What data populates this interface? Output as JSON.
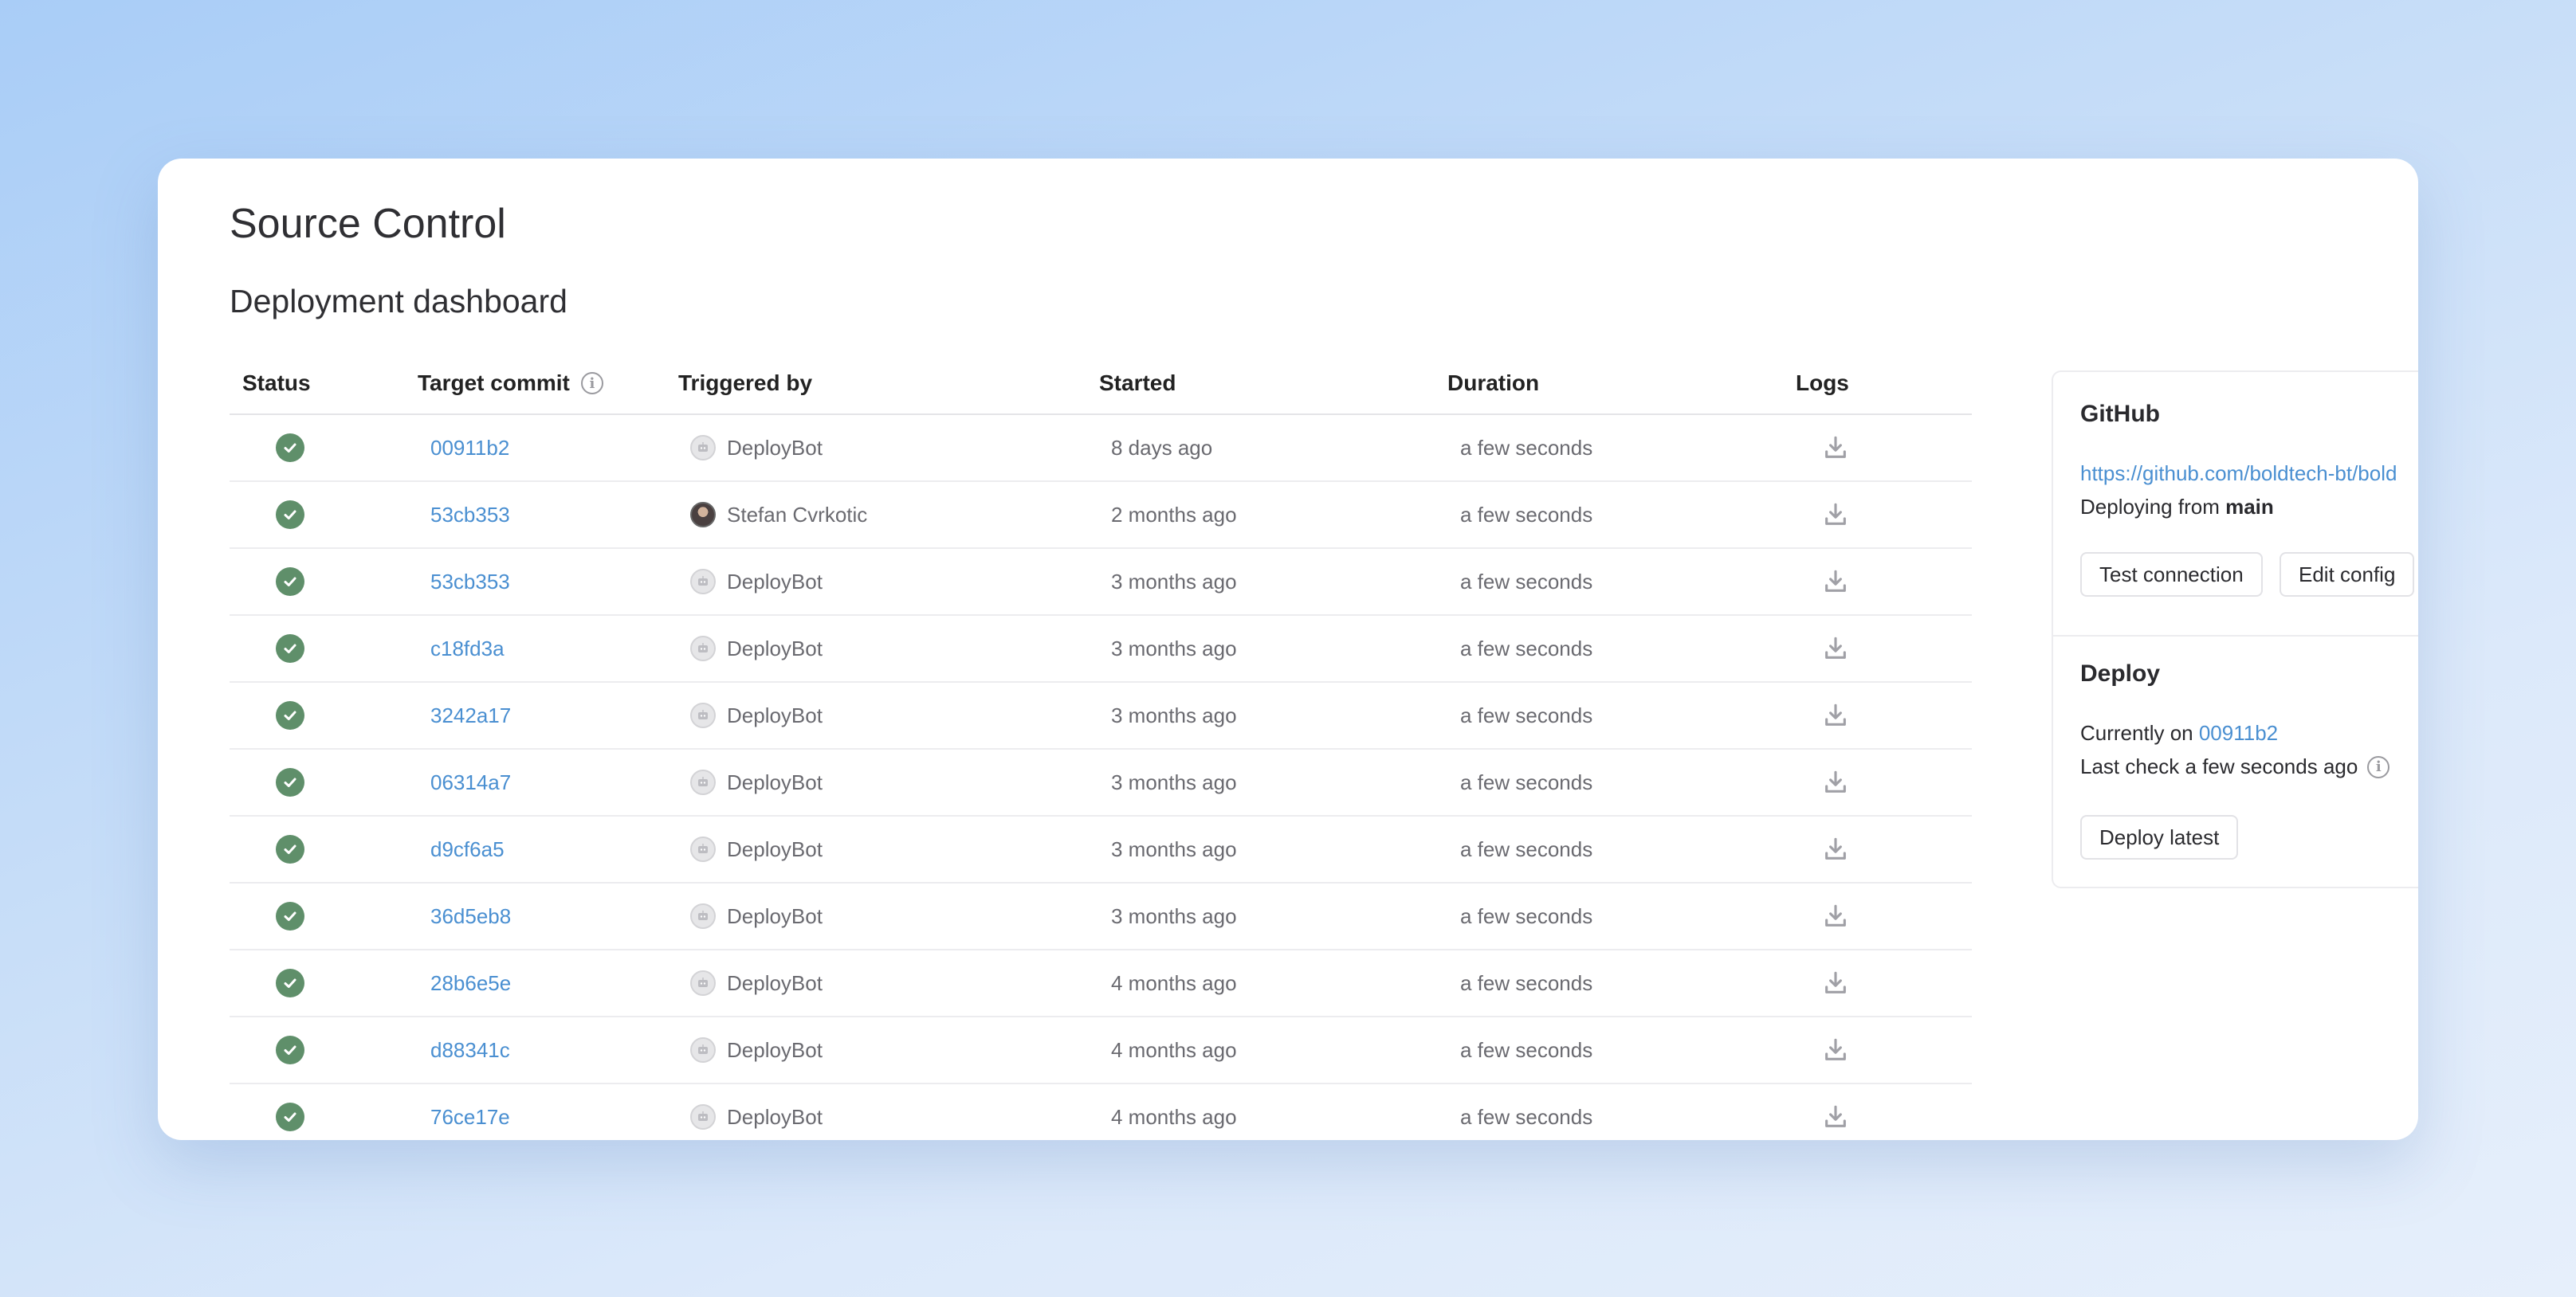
{
  "app_title": "Source Control",
  "section_title": "Deployment dashboard",
  "columns": {
    "status": "Status",
    "target_commit": "Target commit",
    "triggered_by": "Triggered by",
    "started": "Started",
    "duration": "Duration",
    "logs": "Logs"
  },
  "rows": [
    {
      "commit": "00911b2",
      "user": "DeployBot",
      "avatar": "bot",
      "started": "8 days ago",
      "duration": "a few seconds"
    },
    {
      "commit": "53cb353",
      "user": "Stefan Cvrkotic",
      "avatar": "person",
      "started": "2 months ago",
      "duration": "a few seconds"
    },
    {
      "commit": "53cb353",
      "user": "DeployBot",
      "avatar": "bot",
      "started": "3 months ago",
      "duration": "a few seconds"
    },
    {
      "commit": "c18fd3a",
      "user": "DeployBot",
      "avatar": "bot",
      "started": "3 months ago",
      "duration": "a few seconds"
    },
    {
      "commit": "3242a17",
      "user": "DeployBot",
      "avatar": "bot",
      "started": "3 months ago",
      "duration": "a few seconds"
    },
    {
      "commit": "06314a7",
      "user": "DeployBot",
      "avatar": "bot",
      "started": "3 months ago",
      "duration": "a few seconds"
    },
    {
      "commit": "d9cf6a5",
      "user": "DeployBot",
      "avatar": "bot",
      "started": "3 months ago",
      "duration": "a few seconds"
    },
    {
      "commit": "36d5eb8",
      "user": "DeployBot",
      "avatar": "bot",
      "started": "3 months ago",
      "duration": "a few seconds"
    },
    {
      "commit": "28b6e5e",
      "user": "DeployBot",
      "avatar": "bot",
      "started": "4 months ago",
      "duration": "a few seconds"
    },
    {
      "commit": "d88341c",
      "user": "DeployBot",
      "avatar": "bot",
      "started": "4 months ago",
      "duration": "a few seconds"
    },
    {
      "commit": "76ce17e",
      "user": "DeployBot",
      "avatar": "bot",
      "started": "4 months ago",
      "duration": "a few seconds"
    }
  ],
  "panel": {
    "github_title": "GitHub",
    "repo_url": "https://github.com/boldtech-bt/bold",
    "deploying_from_prefix": "Deploying from ",
    "branch": "main",
    "test_connection": "Test connection",
    "edit_config": "Edit config",
    "deploy_title": "Deploy",
    "currently_on_prefix": "Currently on ",
    "current_commit": "00911b2",
    "last_check": "Last check a few seconds ago",
    "deploy_latest": "Deploy latest"
  },
  "colors": {
    "status_success": "#5f8f6a",
    "link": "#4a8fd1"
  },
  "icons": {
    "status": "check-circle-icon",
    "logs": "download-icon",
    "info": "info-icon"
  }
}
